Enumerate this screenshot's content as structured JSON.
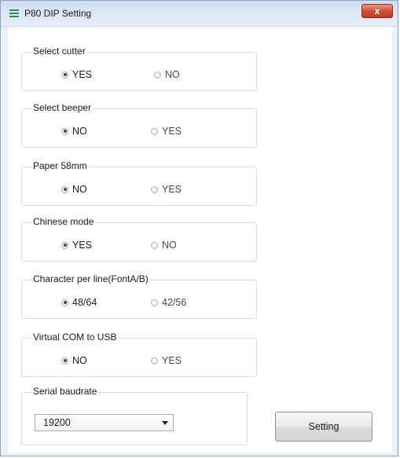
{
  "window": {
    "title": "P80 DIP Setting",
    "close_label": "x"
  },
  "groups": [
    {
      "label": "Select cutter",
      "options": [
        {
          "label": "YES",
          "checked": true
        },
        {
          "label": "NO",
          "checked": false
        }
      ]
    },
    {
      "label": "Select beeper",
      "options": [
        {
          "label": "NO",
          "checked": true
        },
        {
          "label": "YES",
          "checked": false
        }
      ]
    },
    {
      "label": "Paper 58mm",
      "options": [
        {
          "label": "NO",
          "checked": true
        },
        {
          "label": "YES",
          "checked": false
        }
      ]
    },
    {
      "label": "Chinese mode",
      "options": [
        {
          "label": "YES",
          "checked": true
        },
        {
          "label": "NO",
          "checked": false
        }
      ]
    },
    {
      "label": "Character per line(FontA/B)",
      "options": [
        {
          "label": "48/64",
          "checked": true
        },
        {
          "label": "42/56",
          "checked": false
        }
      ]
    },
    {
      "label": "Virtual COM to USB",
      "options": [
        {
          "label": "NO",
          "checked": true
        },
        {
          "label": "YES",
          "checked": false
        }
      ]
    }
  ],
  "baud": {
    "label": "Serial baudrate",
    "selected": "19200"
  },
  "setting_button": "Setting",
  "icons": {
    "title": "window-menu-icon",
    "close": "close-icon",
    "combo": "chevron-down-icon"
  }
}
